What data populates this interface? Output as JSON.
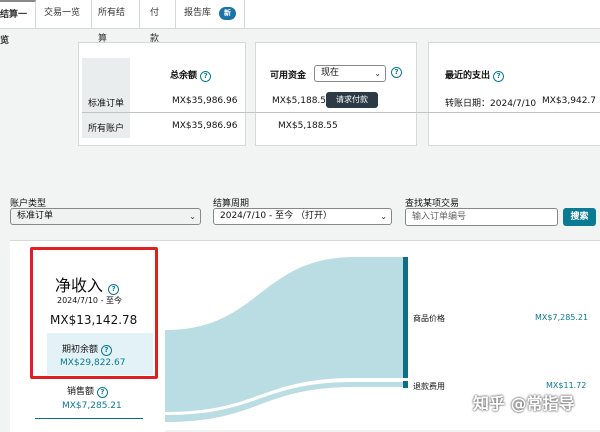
{
  "tabs": {
    "settlements_overview": "结算一览",
    "transactions_overview": "交易一览",
    "all_settlements": "所有结算",
    "payments": "付款",
    "reports": "报告库",
    "new_badge": "新"
  },
  "summary": {
    "row_labels": [
      "标准订单",
      "所有账户"
    ],
    "total_balance": {
      "title": "总余额",
      "values": [
        "MX$35,986.96",
        "MX$35,986.96"
      ]
    },
    "available_funds": {
      "title": "可用资金",
      "select_value": "现在",
      "request_button": "请求付款",
      "values": [
        "MX$5,188.55",
        "MX$5,188.55"
      ]
    },
    "recent_spend": {
      "title": "最近的支出",
      "transfer_date_label": "转账日期：",
      "transfer_date": "2024/7/10",
      "amount": "MX$3,942.7"
    }
  },
  "filters": {
    "account_type_label": "账户类型",
    "account_type_value": "标准订单",
    "period_label": "结算周期",
    "period_value": "2024/7/10 - 至今 （打开）",
    "search_label": "查找某项交易",
    "search_placeholder": "输入订单编号",
    "search_button": "搜索"
  },
  "net_income": {
    "title": "净收入",
    "date_range": "2024/7/10 - 至今",
    "amount": "MX$13,142.78",
    "opening_label": "期初余额",
    "opening_amount": "MX$29,822.67",
    "sales_label": "销售额",
    "sales_amount": "MX$7,285.21"
  },
  "flow": {
    "items": [
      {
        "label": "商品价格",
        "amount": "MX$7,285.21"
      },
      {
        "label": "退款费用",
        "amount": "MX$11.72"
      }
    ]
  },
  "watermark": "知乎 @常指导"
}
